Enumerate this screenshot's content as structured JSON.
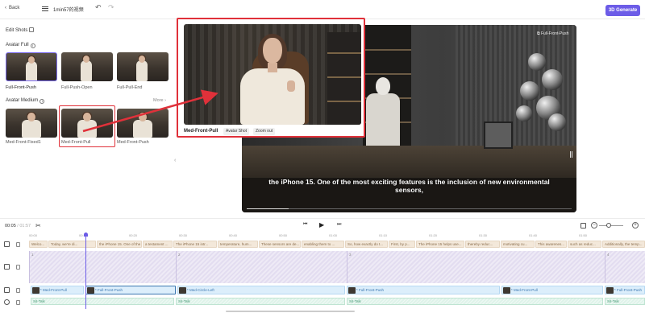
{
  "header": {
    "back_label": "Back",
    "project_title": "1min57的视频",
    "generate_label": "3D Generate",
    "accent": "#6c5ce7"
  },
  "left_panel": {
    "title": "Edit Shots",
    "avatar_full": {
      "title": "Avatar Full",
      "shots": [
        "Full-Front-Push",
        "Full-Push-Open",
        "Full-Pull-End"
      ]
    },
    "avatar_medium": {
      "title": "Avatar Medium",
      "more_label": "More",
      "shots": [
        "Med-Front-Fixed1",
        "Med-Front-Pull",
        "Med-Front-Push"
      ]
    }
  },
  "callout": {
    "shot_label": "Med-Front-Pull",
    "tags": [
      "Avatar Shot",
      "Zoom out"
    ],
    "highlight_color": "#e0313a"
  },
  "preview": {
    "tag": "Full-Front-Push",
    "subtitle": "the iPhone 15. One of the most exciting features is the inclusion of new environmental sensors,",
    "progress_fraction": 0.13
  },
  "controls": {
    "current_time": "00:05",
    "duration": "/ 01:57"
  },
  "timeline": {
    "ruler": [
      "00:00",
      "00:10",
      "00:20",
      "00:30",
      "00:40",
      "00:50",
      "01:00",
      "01:10",
      "01:20",
      "01:30",
      "01:40",
      "01:50"
    ],
    "text_segments": [
      "Welco...",
      "Today, we're di...",
      "the iPhone 15. One of the ex...",
      "a testament ...",
      "The iPhone 15 intr...",
      "temperature, hum...",
      "These sensors are de...",
      "enabling them to ...",
      "So, how exactly do t...",
      "First, by p...",
      "The iPhone 15 helps use...",
      "thereby reduc...",
      "motivating cu...",
      "This awarenes...",
      "such as reduc...",
      "Additionally, the temp..."
    ],
    "motion_segments": [
      "1",
      "2",
      "3",
      "4"
    ],
    "shot_segments": [
      "Med-Front-Pull",
      "Full-Front-Push",
      "Med-Circle-Left",
      "Full-Front-Push",
      "Med-Front-Pull",
      "Full-Front-Push"
    ],
    "voice_segments": [
      "Sit-Talk",
      "Sit-Talk",
      "Sit-Talk",
      "Sit-Talk"
    ]
  }
}
